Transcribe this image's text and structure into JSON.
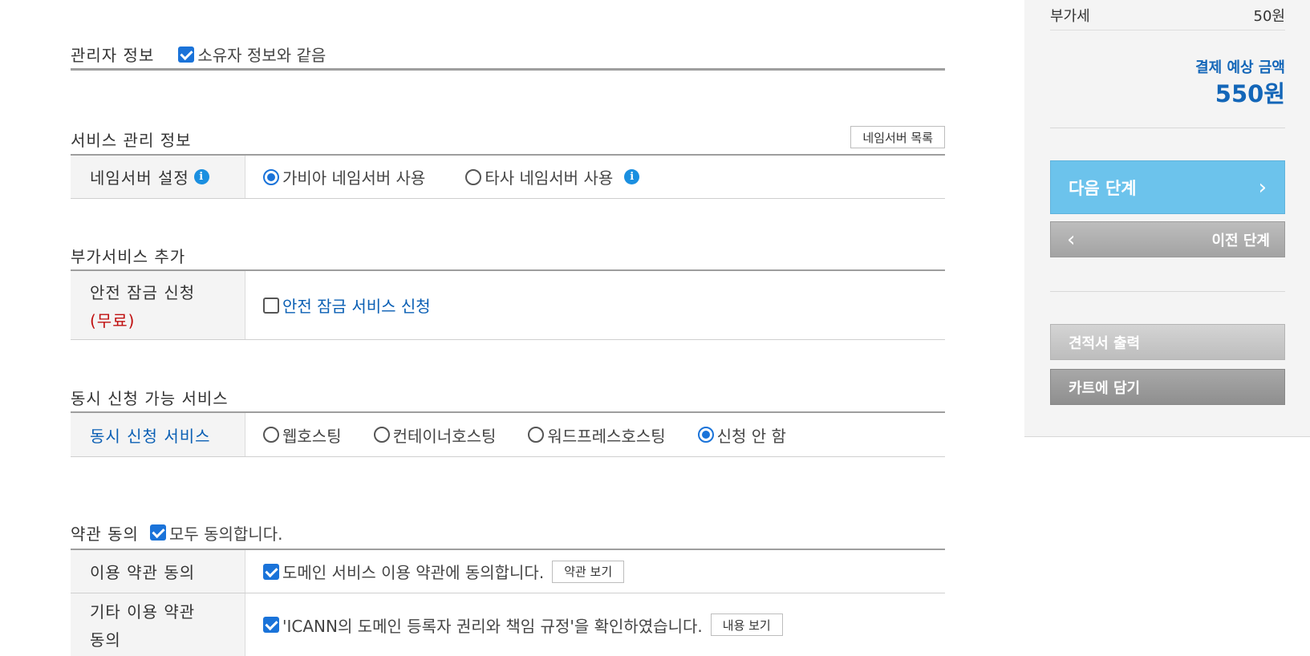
{
  "admin": {
    "title": "관리자 정보",
    "same_owner_label": "소유자 정보와 같음"
  },
  "service_mgmt": {
    "title": "서비스 관리 정보",
    "ns_list_button": "네임서버 목록",
    "ns_label": "네임서버 설정",
    "ns_options": [
      "가비아 네임서버 사용",
      "타사 네임서버 사용"
    ]
  },
  "addon": {
    "title": "부가서비스 추가",
    "lock_label": "안전 잠금 신청",
    "lock_free": "(무료)",
    "lock_option": "안전 잠금 서비스 신청"
  },
  "concurrent": {
    "title": "동시 신청 가능 서비스",
    "label": "동시 신청 서비스",
    "options": [
      "웹호스팅",
      "컨테이너호스팅",
      "워드프레스호스팅",
      "신청 안 함"
    ]
  },
  "terms": {
    "title": "약관 동의",
    "agree_all": "모두 동의합니다.",
    "use_label": "이용 약관 동의",
    "use_text": "도메인 서비스 이용 약관에 동의합니다.",
    "use_button": "약관 보기",
    "other_label_1": "기타 이용 약관",
    "other_label_2": "동의",
    "other_text": "'ICANN의 도메인 등록자 권리와 책임 규정'을 확인하였습니다.",
    "other_button": "내용 보기"
  },
  "sidebar": {
    "vat_label": "부가세",
    "vat_value": "50원",
    "pay_label": "결제 예상 금액",
    "pay_total": "550원",
    "next_button": "다음 단계",
    "prev_button": "이전 단계",
    "quote_button": "견적서 출력",
    "cart_button": "카트에 담기"
  },
  "colors": {
    "accent": "#1a73d9",
    "next_button": "#6cc3ec",
    "total": "#1366b8"
  }
}
